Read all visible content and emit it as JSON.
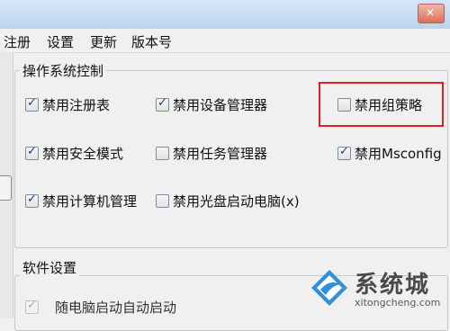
{
  "menu": [
    "注册",
    "设置",
    "更新",
    "版本号"
  ],
  "os_control": {
    "title": "操作系统控制",
    "items": [
      {
        "label": "禁用注册表",
        "checked": true
      },
      {
        "label": "禁用设备管理器",
        "checked": true
      },
      {
        "label": "禁用组策略",
        "checked": false
      },
      {
        "label": "禁用安全模式",
        "checked": true
      },
      {
        "label": "禁用任务管理器",
        "checked": false
      },
      {
        "label": "禁用Msconfig",
        "checked": true
      },
      {
        "label": "禁用计算机管理",
        "checked": true
      },
      {
        "label": "禁用光盘启动电脑(x)",
        "checked": false
      }
    ]
  },
  "software": {
    "title": "软件设置",
    "items": [
      {
        "label": "随电脑启动自动启动",
        "checked": true,
        "disabled": true
      }
    ]
  },
  "watermark": {
    "brand": "系统城",
    "url": "xitongcheng.com"
  },
  "colors": {
    "highlight": "#e02020",
    "check": "#1f3b78"
  }
}
